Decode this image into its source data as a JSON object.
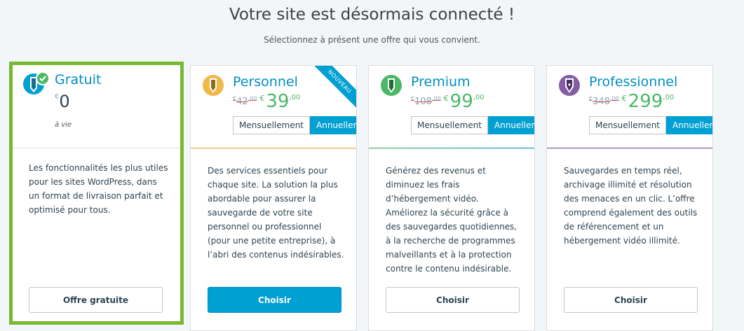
{
  "header": {
    "title": "Votre site est désormais connecté !",
    "subtitle": "Sélectionnez à présent une offre qui vous convient."
  },
  "plans": [
    {
      "name": "Gratuit",
      "currency": "€",
      "price": "0",
      "term": "à vie",
      "description": "Les fonctionnalités les plus utiles pour les sites WordPress, dans un format de livraison parfait et optimisé pour tous.",
      "button": "Offre gratuite",
      "icon": "pencil-check-icon",
      "color": "#00a0d2"
    },
    {
      "name": "Personnel",
      "old_price": "42",
      "old_cents": ",00",
      "currency": "€",
      "price": "39",
      "cents": ",00",
      "toggle_monthly": "Mensuellement",
      "toggle_yearly": "Annuellement",
      "badge": "NOUVEAU",
      "description": "Des services essentiels pour chaque site. La solution la plus abordable pour assurer la sauvegarde de votre site personnel ou professionnel (pour une petite entreprise), à l’abri des contenus indésirables.",
      "button": "Choisir",
      "icon": "pencil-yellow-icon",
      "color": "#f0b849"
    },
    {
      "name": "Premium",
      "old_price": "108",
      "old_cents": ",00",
      "currency": "€",
      "price": "99",
      "cents": ",00",
      "toggle_monthly": "Mensuellement",
      "toggle_yearly": "Annuellement",
      "description": "Générez des revenus et diminuez les frais d’hébergement vidéo. Améliorez la sécurité grâce à des sauvegardes quotidiennes, à la recherche de programmes malveillants et à la protection contre le contenu indésirable.",
      "button": "Choisir",
      "icon": "pencil-green-icon",
      "color": "#4ab866"
    },
    {
      "name": "Professionnel",
      "old_price": "348",
      "old_cents": ",00",
      "currency": "€",
      "price": "299",
      "cents": ",00",
      "toggle_monthly": "Mensuellement",
      "toggle_yearly": "Annuellement",
      "description": "Sauvegardes en temps réel, archivage illimité et résolution des menaces en un clic. L’offre comprend également des outils de référencement et un hébergement vidéo illimité.",
      "button": "Choisir",
      "icon": "fountain-pen-purple-icon",
      "color": "#855da6"
    }
  ]
}
